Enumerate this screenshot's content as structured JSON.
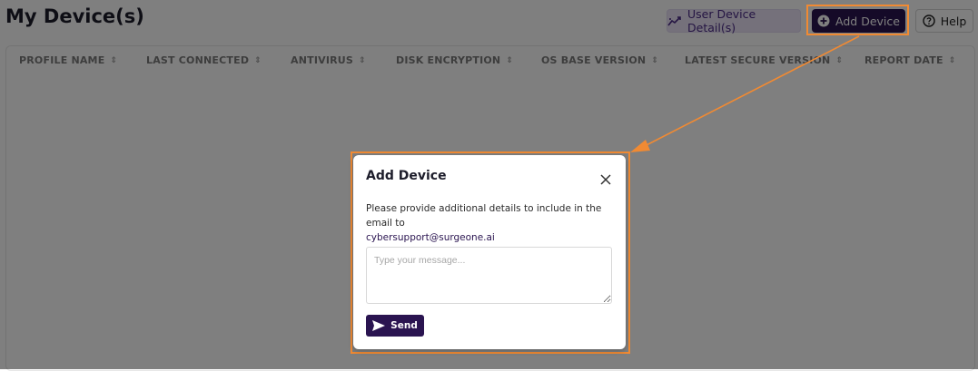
{
  "page": {
    "title": "My Device(s)"
  },
  "toolbar": {
    "user_device_details_label": "User Device Detail(s)",
    "add_device_label": "Add Device",
    "help_label": "Help"
  },
  "table": {
    "columns": [
      "PROFILE NAME",
      "LAST CONNECTED",
      "ANTIVIRUS",
      "DISK ENCRYPTION",
      "OS BASE VERSION",
      "LATEST SECURE VERSION",
      "REPORT DATE"
    ],
    "sort_icon": "sort-icon"
  },
  "modal": {
    "title": "Add Device",
    "description": "Please provide additional details to include in the email to",
    "email": "cybersupport@surgeone.ai",
    "message_placeholder": "Type your message...",
    "send_label": "Send"
  },
  "icons": {
    "details": "trend-icon",
    "add": "plus-circle-icon",
    "help": "help-circle-icon",
    "close": "close-icon",
    "send": "send-icon"
  },
  "colors": {
    "accent_dark": "#2a1450",
    "accent_light": "#eae3f6",
    "highlight": "#f08a33"
  }
}
